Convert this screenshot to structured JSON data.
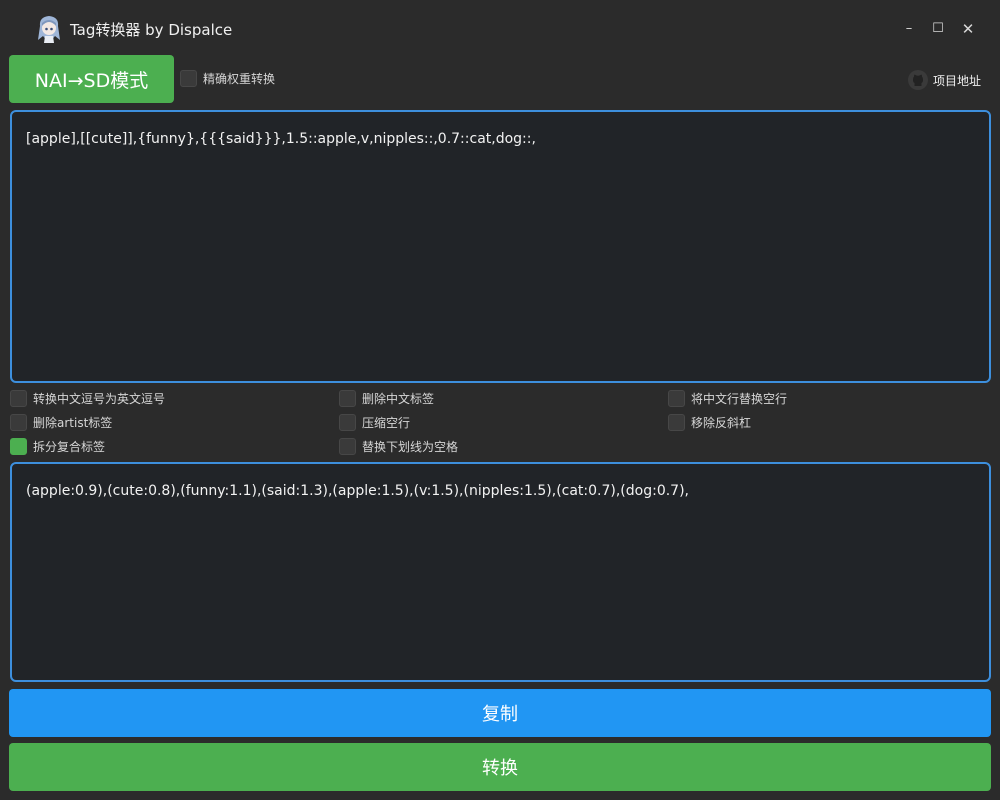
{
  "window": {
    "title": "Tag转换器 by Dispalce",
    "minimize_glyph": "–",
    "maximize_glyph": "☐",
    "close_glyph": "✕"
  },
  "toolbar": {
    "mode_button": "NAI→SD模式",
    "precise_weight_label": "精确权重转换",
    "precise_weight_checked": false,
    "repo_link": "项目地址",
    "repo_icon": "github-icon"
  },
  "input_text": "[apple],[[cute]],{funny},{{{said}}},1.5::apple,v,nipples::,0.7::cat,dog::,",
  "options": [
    {
      "label": "转换中文逗号为英文逗号",
      "checked": false
    },
    {
      "label": "删除中文标签",
      "checked": false
    },
    {
      "label": "将中文行替换空行",
      "checked": false
    },
    {
      "label": "删除artist标签",
      "checked": false
    },
    {
      "label": "压缩空行",
      "checked": false
    },
    {
      "label": "移除反斜杠",
      "checked": false
    },
    {
      "label": "拆分复合标签",
      "checked": true
    },
    {
      "label": "替换下划线为空格",
      "checked": false
    }
  ],
  "output_text": "(apple:0.9),(cute:0.8),(funny:1.1),(said:1.3),(apple:1.5),(v:1.5),(nipples:1.5),(cat:0.7),(dog:0.7),",
  "actions": {
    "copy_label": "复制",
    "convert_label": "转换"
  },
  "colors": {
    "background": "#2b2b2b",
    "text_area_bg": "#212428",
    "focus_border": "#3d8fdd",
    "green_button": "#4caf50",
    "blue_button": "#2196f3"
  }
}
